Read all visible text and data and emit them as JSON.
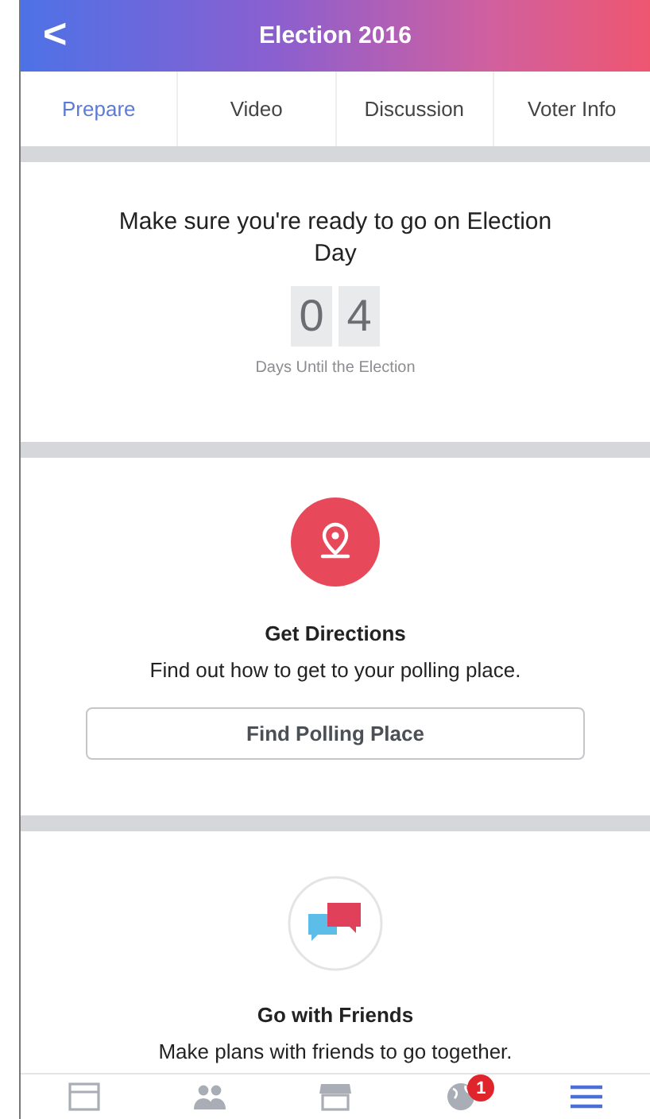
{
  "header": {
    "back": "<",
    "title": "Election 2016"
  },
  "tabs": [
    {
      "label": "Prepare",
      "selected": true
    },
    {
      "label": "Video",
      "selected": false
    },
    {
      "label": "Discussion",
      "selected": false
    },
    {
      "label": "Voter Info",
      "selected": false
    }
  ],
  "countdown": {
    "heading": "Make sure you're ready to go on Election Day",
    "digits": [
      "0",
      "4"
    ],
    "caption": "Days Until the Election"
  },
  "directions": {
    "title": "Get Directions",
    "text": "Find out how to get to your polling place.",
    "button": "Find Polling Place"
  },
  "friends": {
    "title": "Go with Friends",
    "text": "Make plans with friends to go together."
  },
  "nav": [
    {
      "kind": "feed",
      "selected": false
    },
    {
      "kind": "friends",
      "selected": false
    },
    {
      "kind": "marketplace",
      "selected": false
    },
    {
      "kind": "globe",
      "selected": false,
      "badge": "1"
    },
    {
      "kind": "menu",
      "selected": true
    }
  ]
}
